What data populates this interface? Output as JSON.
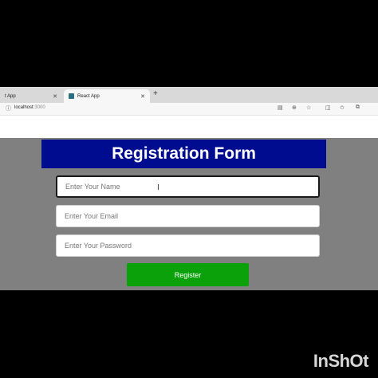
{
  "browser": {
    "tabs": [
      {
        "label": "t App"
      },
      {
        "label": "React App"
      }
    ],
    "url_host": "localhost",
    "url_port": ":3000",
    "icons": [
      "info-icon",
      "reader-icon",
      "zoom-icon",
      "favorite-icon",
      "split-screen-icon",
      "favorites-bar-icon",
      "extensions-icon"
    ]
  },
  "form": {
    "title": "Registration Form",
    "name_placeholder": "Enter Your Name",
    "email_placeholder": "Enter Your Email",
    "password_placeholder": "Enter Your Password",
    "register_label": "Register"
  },
  "watermark": "InShOt",
  "colors": {
    "header_bg": "#000c8f",
    "page_bg": "#808080",
    "button_bg": "#0aa10a"
  }
}
